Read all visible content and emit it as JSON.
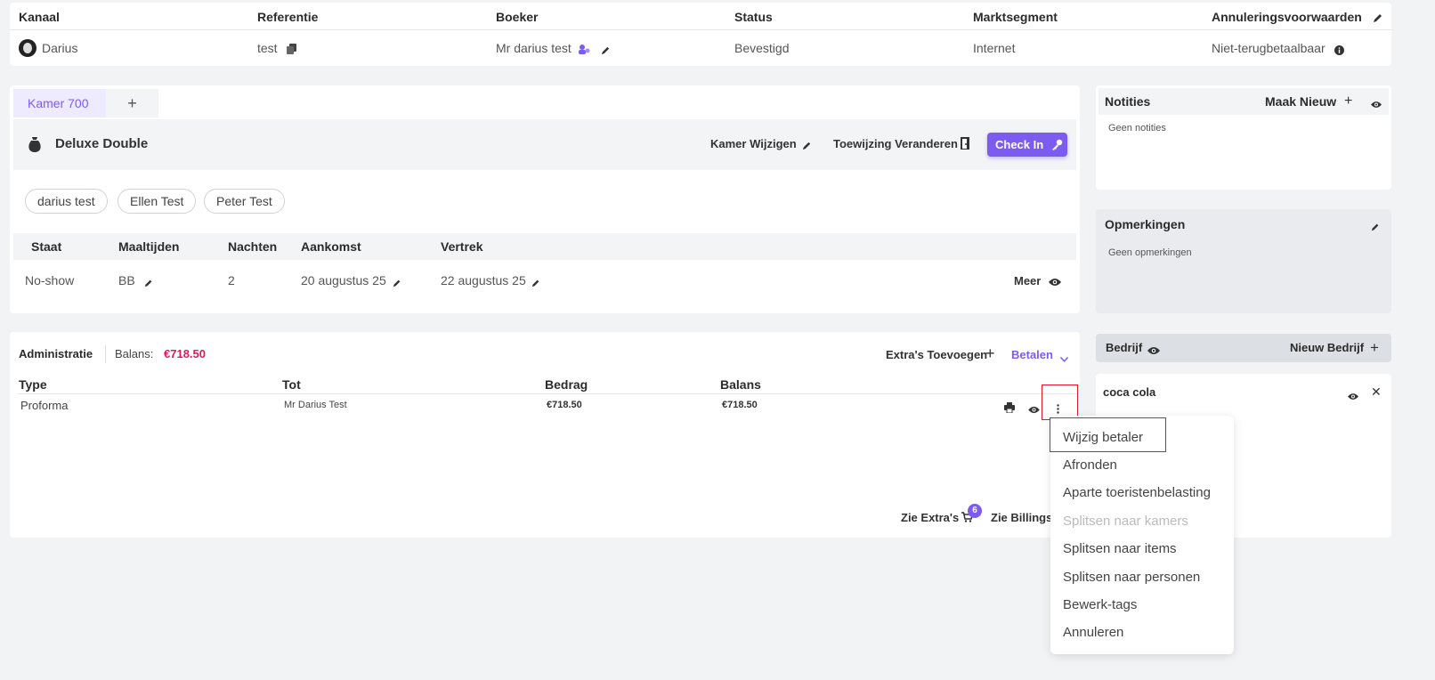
{
  "booking_header": {
    "columns": [
      "Kanaal",
      "Referentie",
      "Boeker",
      "Status",
      "Marktsegment",
      "Annuleringsvoorwaarden"
    ],
    "channel": "Darius",
    "reference": "test",
    "booker": "Mr darius test",
    "status": "Bevestigd",
    "market_segment": "Internet",
    "cancellation": "Niet-terugbetaalbaar"
  },
  "room": {
    "tab_label": "Kamer 700",
    "add_tab": "+",
    "room_type": "Deluxe Double",
    "change_room": "Kamer Wijzigen",
    "change_assignment": "Toewijzing Veranderen",
    "check_in": "Check In",
    "guests": [
      "darius test",
      "Ellen Test",
      "Peter Test"
    ],
    "table_headers": [
      "Staat",
      "Maaltijden",
      "Nachten",
      "Aankomst",
      "Vertrek"
    ],
    "state": "No-show",
    "meals": "BB",
    "nights": "2",
    "arrival": "20 augustus 25",
    "departure": "22 augustus 25",
    "more": "Meer"
  },
  "notes": {
    "title": "Notities",
    "new_label": "Maak Nieuw",
    "empty": "Geen notities"
  },
  "remarks": {
    "title": "Opmerkingen",
    "empty": "Geen opmerkingen"
  },
  "company": {
    "title": "Bedrijf",
    "new_label": "Nieuw Bedrijf",
    "name": "coca cola"
  },
  "administration": {
    "title": "Administratie",
    "balance_label": "Balans:",
    "balance_value": "€718.50",
    "add_extras": "Extra's Toevoegen",
    "pay": "Betalen",
    "table_headers": [
      "Type",
      "Tot",
      "Bedrag",
      "Balans"
    ],
    "row": {
      "type": "Proforma",
      "to": "Mr Darius Test",
      "amount": "€718.50",
      "balance": "€718.50"
    },
    "see_extras": "Zie Extra's",
    "extras_count": "6",
    "see_billings": "Zie Billings"
  },
  "context_menu": {
    "items": [
      "Wijzig betaler",
      "Afronden",
      "Aparte toeristenbelasting",
      "Splitsen naar kamers",
      "Splitsen naar items",
      "Splitsen naar personen",
      "Bewerk-tags",
      "Annuleren"
    ],
    "disabled_index": 3
  },
  "colors": {
    "accent": "#7c5cf0",
    "balance_red": "#e0195a",
    "highlight": "#e0192b"
  }
}
